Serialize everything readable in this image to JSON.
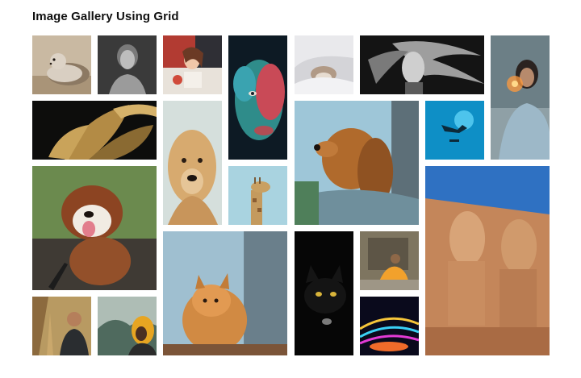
{
  "page": {
    "title": "Image Gallery Using Grid"
  },
  "gallery": {
    "images": [
      {
        "subject": "seal"
      },
      {
        "subject": "woman-portrait-bw"
      },
      {
        "subject": "woman-eating"
      },
      {
        "subject": "painted-face"
      },
      {
        "subject": "cat-in-blanket"
      },
      {
        "subject": "woman-windblown-hair-bw"
      },
      {
        "subject": "woman-sparkler"
      },
      {
        "subject": "golden-leaves"
      },
      {
        "subject": "golden-retriever"
      },
      {
        "subject": "dog-in-car"
      },
      {
        "subject": "scuba-diver"
      },
      {
        "subject": "fluffy-puppy"
      },
      {
        "subject": "giraffe"
      },
      {
        "subject": "egyptian-statues"
      },
      {
        "subject": "orange-cat"
      },
      {
        "subject": "black-cat"
      },
      {
        "subject": "monk"
      },
      {
        "subject": "man-with-plants"
      },
      {
        "subject": "hooded-person"
      },
      {
        "subject": "carnival-ride"
      }
    ]
  },
  "colors": {
    "background": "#ffffff",
    "title": "#111111"
  }
}
